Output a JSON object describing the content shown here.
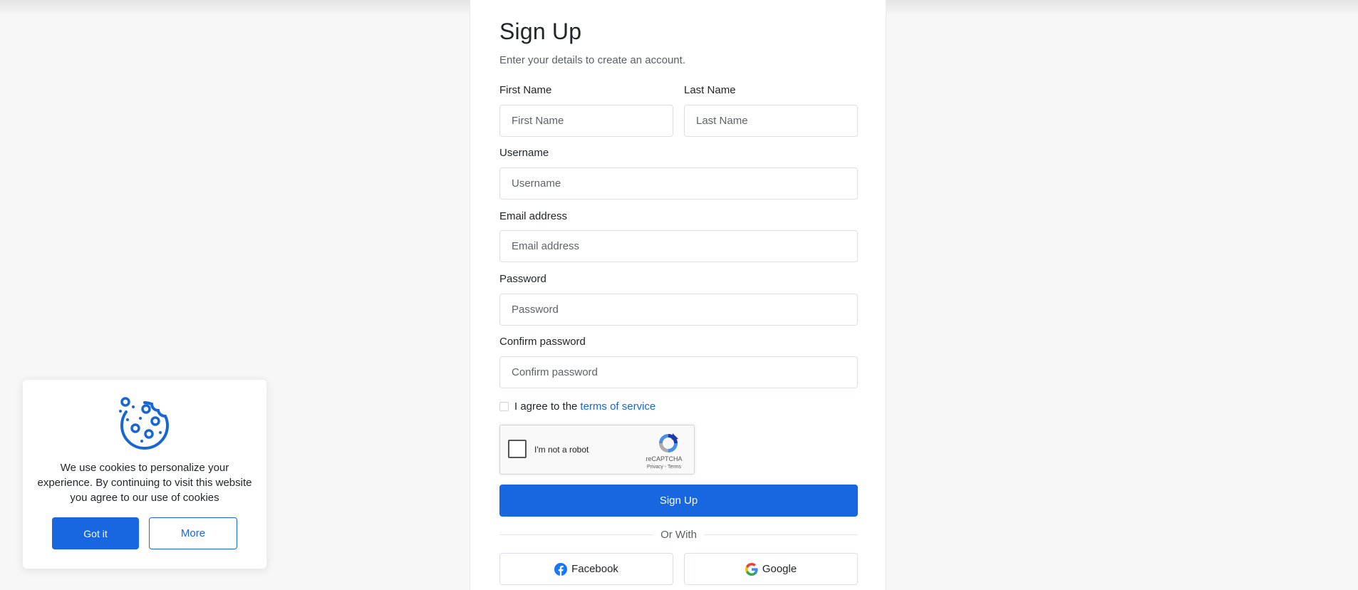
{
  "form": {
    "title": "Sign Up",
    "subtitle": "Enter your details to create an account.",
    "fields": {
      "first_name": {
        "label": "First Name",
        "placeholder": "First Name",
        "value": ""
      },
      "last_name": {
        "label": "Last Name",
        "placeholder": "Last Name",
        "value": ""
      },
      "username": {
        "label": "Username",
        "placeholder": "Username",
        "value": ""
      },
      "email": {
        "label": "Email address",
        "placeholder": "Email address",
        "value": ""
      },
      "password": {
        "label": "Password",
        "placeholder": "Password",
        "value": ""
      },
      "confirm_password": {
        "label": "Confirm password",
        "placeholder": "Confirm password",
        "value": ""
      }
    },
    "terms": {
      "prefix": "I agree to the",
      "link": "terms of service",
      "checked": false
    },
    "recaptcha": {
      "label": "I'm not a robot",
      "brand": "reCAPTCHA",
      "links": "Privacy - Terms",
      "icon": "recaptcha-logo-icon"
    },
    "submit_label": "Sign Up",
    "divider_text": "Or With",
    "social": {
      "facebook": {
        "label": "Facebook",
        "icon": "facebook-icon",
        "color": "#1877f2"
      },
      "google": {
        "label": "Google",
        "icon": "google-icon"
      }
    }
  },
  "cookie_banner": {
    "icon": "cookie-icon",
    "text": "We use cookies to personalize your experience. By continuing to visit this website you agree to our use of cookies",
    "accept_label": "Got it",
    "more_label": "More"
  },
  "colors": {
    "accent": "#1866e0",
    "link": "#1866d4",
    "background": "#f7f7f7"
  }
}
